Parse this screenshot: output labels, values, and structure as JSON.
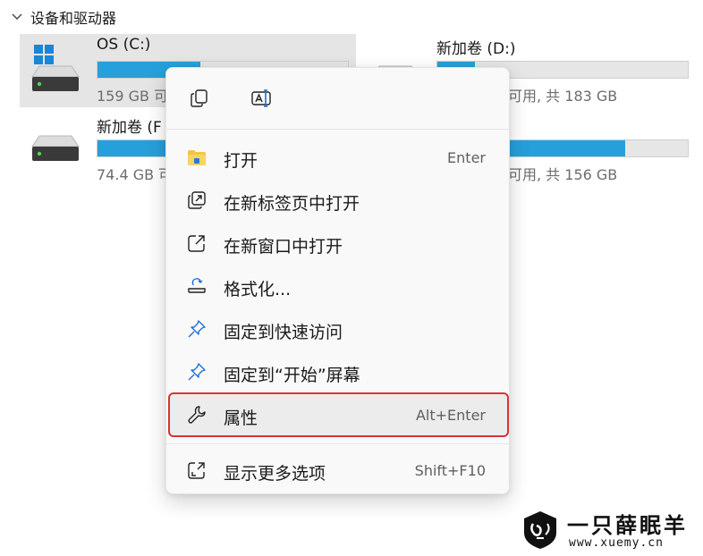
{
  "section": {
    "title": "设备和驱动器"
  },
  "drives": [
    {
      "name": "OS (C:)",
      "sub": "159 GB 可",
      "usage": 0.41,
      "selected": true
    },
    {
      "name": "新加卷 (D:)",
      "sub": "可用, 共 183 GB",
      "usage": 0.15
    },
    {
      "name": "新加卷 (F",
      "sub": "74.4 GB 可",
      "usage": 0.28
    },
    {
      "name": ")",
      "sub": "可用, 共 156 GB",
      "usage": 0.75
    }
  ],
  "menu": {
    "top_icons": [
      "copy-icon",
      "rename-icon"
    ],
    "items": [
      {
        "label": "打开",
        "shortcut": "Enter",
        "icon": "folder-icon"
      },
      {
        "label": "在新标签页中打开",
        "shortcut": "",
        "icon": "open-new-tab-icon"
      },
      {
        "label": "在新窗口中打开",
        "shortcut": "",
        "icon": "open-new-window-icon"
      },
      {
        "label": "格式化...",
        "shortcut": "",
        "icon": "format-icon"
      },
      {
        "label": "固定到快速访问",
        "shortcut": "",
        "icon": "pin-icon"
      },
      {
        "label": "固定到“开始”屏幕",
        "shortcut": "",
        "icon": "pin-icon"
      },
      {
        "label": "属性",
        "shortcut": "Alt+Enter",
        "icon": "wrench-icon",
        "highlighted": true
      },
      {
        "label": "显示更多选项",
        "shortcut": "Shift+F10",
        "icon": "more-options-icon"
      }
    ]
  },
  "watermark": {
    "title": "一只薛眠羊",
    "url": "www.xuemy.cn"
  },
  "colors": {
    "accent": "#26a0da",
    "highlight_outline": "#d83434",
    "folder": "#f4c542"
  }
}
